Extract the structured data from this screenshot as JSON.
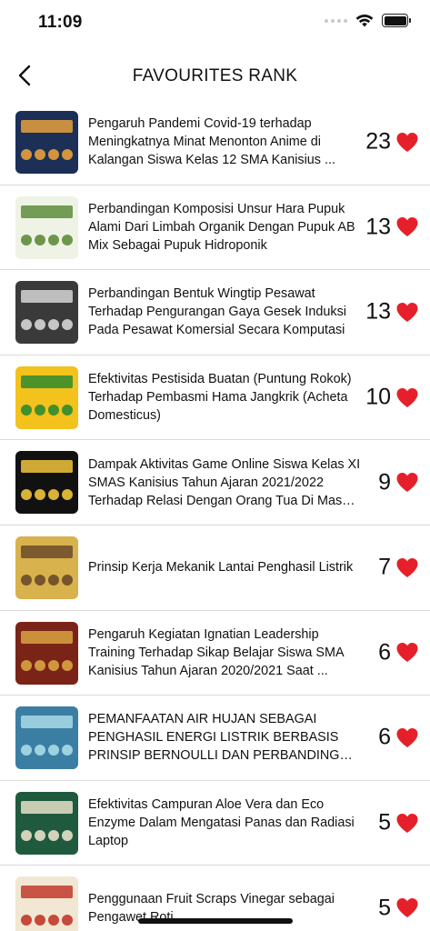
{
  "status": {
    "time": "11:09"
  },
  "nav": {
    "title": "FAVOURITES RANK",
    "back_icon": "chevron-left-icon"
  },
  "colors": {
    "heart": "#e5202a",
    "divider": "#dadada",
    "text": "#111111"
  },
  "items": [
    {
      "title": "Pengaruh Pandemi Covid-19 terhadap Meningkatnya Minat Menonton Anime di Kalangan Siswa Kelas 12 SMA Kanisius ...",
      "count": "23",
      "thumb_bg": "#1b2f57",
      "thumb_accent": "#e8a03c"
    },
    {
      "title": "Perbandingan Komposisi Unsur Hara Pupuk Alami Dari Limbah Organik Dengan Pupuk AB Mix Sebagai Pupuk Hidroponik",
      "count": "13",
      "thumb_bg": "#eef3e6",
      "thumb_accent": "#5e8c3a"
    },
    {
      "title": "Perbandingan Bentuk Wingtip Pesawat Terhadap Pengurangan Gaya Gesek Induksi Pada Pesawat Komersial Secara Komputasi",
      "count": "13",
      "thumb_bg": "#3a3a3a",
      "thumb_accent": "#d6d6d6"
    },
    {
      "title": "Efektivitas Pestisida Buatan (Puntung Rokok) Terhadap Pembasmi Hama Jangkrik (Acheta Domesticus)",
      "count": "10",
      "thumb_bg": "#f3c21c",
      "thumb_accent": "#2e8b2e"
    },
    {
      "title": "Dampak Aktivitas Game Online Siswa Kelas XI SMAS Kanisius Tahun Ajaran 2021/2022 Terhadap Relasi Dengan Orang Tua Di Masa ...",
      "count": "9",
      "thumb_bg": "#111111",
      "thumb_accent": "#f0c43c"
    },
    {
      "title": "Prinsip Kerja Mekanik Lantai Penghasil Listrik",
      "count": "7",
      "thumb_bg": "#d8b24c",
      "thumb_accent": "#6b4a2a"
    },
    {
      "title": "Pengaruh Kegiatan Ignatian Leadership Training Terhadap Sikap Belajar Siswa SMA Kanisius Tahun Ajaran 2020/2021 Saat ...",
      "count": "6",
      "thumb_bg": "#7a2418",
      "thumb_accent": "#d9a441"
    },
    {
      "title": "PEMANFAATAN AIR HUJAN SEBAGAI PENGHASIL ENERGI LISTRIK BERBASIS PRINSIP BERNOULLI DAN PERBANDINGAN FILTRASI MENGGUNAKAN...",
      "count": "6",
      "thumb_bg": "#3a7fa3",
      "thumb_accent": "#a9dbe8"
    },
    {
      "title": "Efektivitas Campuran Aloe Vera dan Eco Enzyme Dalam Mengatasi Panas dan Radiasi Laptop",
      "count": "5",
      "thumb_bg": "#1f5a3e",
      "thumb_accent": "#e6e0c8"
    },
    {
      "title": "Penggunaan Fruit Scraps Vinegar sebagai Pengawet Roti",
      "count": "5",
      "thumb_bg": "#f1e7d2",
      "thumb_accent": "#c0392b"
    }
  ]
}
